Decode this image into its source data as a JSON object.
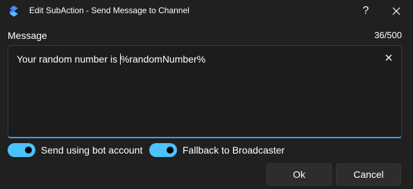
{
  "window": {
    "title": "Edit SubAction - Send Message to Channel",
    "app_icon": "streamerbot-logo-icon",
    "help_icon": "question-mark-icon",
    "close_icon": "close-icon"
  },
  "message": {
    "label": "Message",
    "char_count": "36/500",
    "value_before_caret": "Your random number is ",
    "value_after_caret": "%randomNumber%",
    "clear_icon": "close-icon",
    "focus_color": "#3ea0f0"
  },
  "options": [
    {
      "label": "Send using bot account",
      "checked": true
    },
    {
      "label": "Fallback to Broadcaster",
      "checked": true
    }
  ],
  "buttons": {
    "ok_label": "Ok",
    "cancel_label": "Cancel"
  },
  "colors": {
    "background": "#202020",
    "toggle_on": "#4cc2ff"
  }
}
